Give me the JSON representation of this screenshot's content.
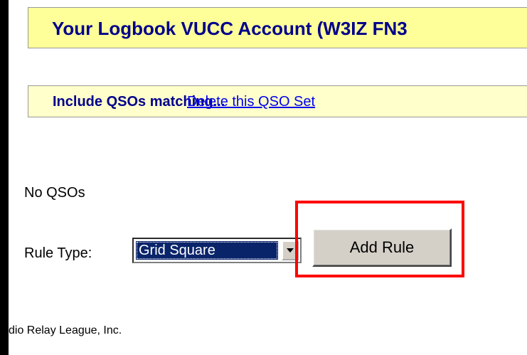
{
  "header": {
    "title": "Your Logbook VUCC Account (W3IZ FN3"
  },
  "qso_set": {
    "label": "Include QSOs matching...",
    "delete_link": "Delete this QSO Set"
  },
  "status": {
    "no_qsos": "No QSOs"
  },
  "rule": {
    "type_label": "Rule Type:",
    "selected_type": "Grid Square",
    "add_button": "Add Rule"
  },
  "footer": {
    "text": "dio Relay League, Inc."
  },
  "colors": {
    "title_bar_bg": "#ffff99",
    "title_text": "#00008b",
    "qso_bar_bg": "#ffffcc",
    "link": "#0000ee",
    "select_highlight": "#0a246a",
    "annotation": "#ff0000"
  }
}
